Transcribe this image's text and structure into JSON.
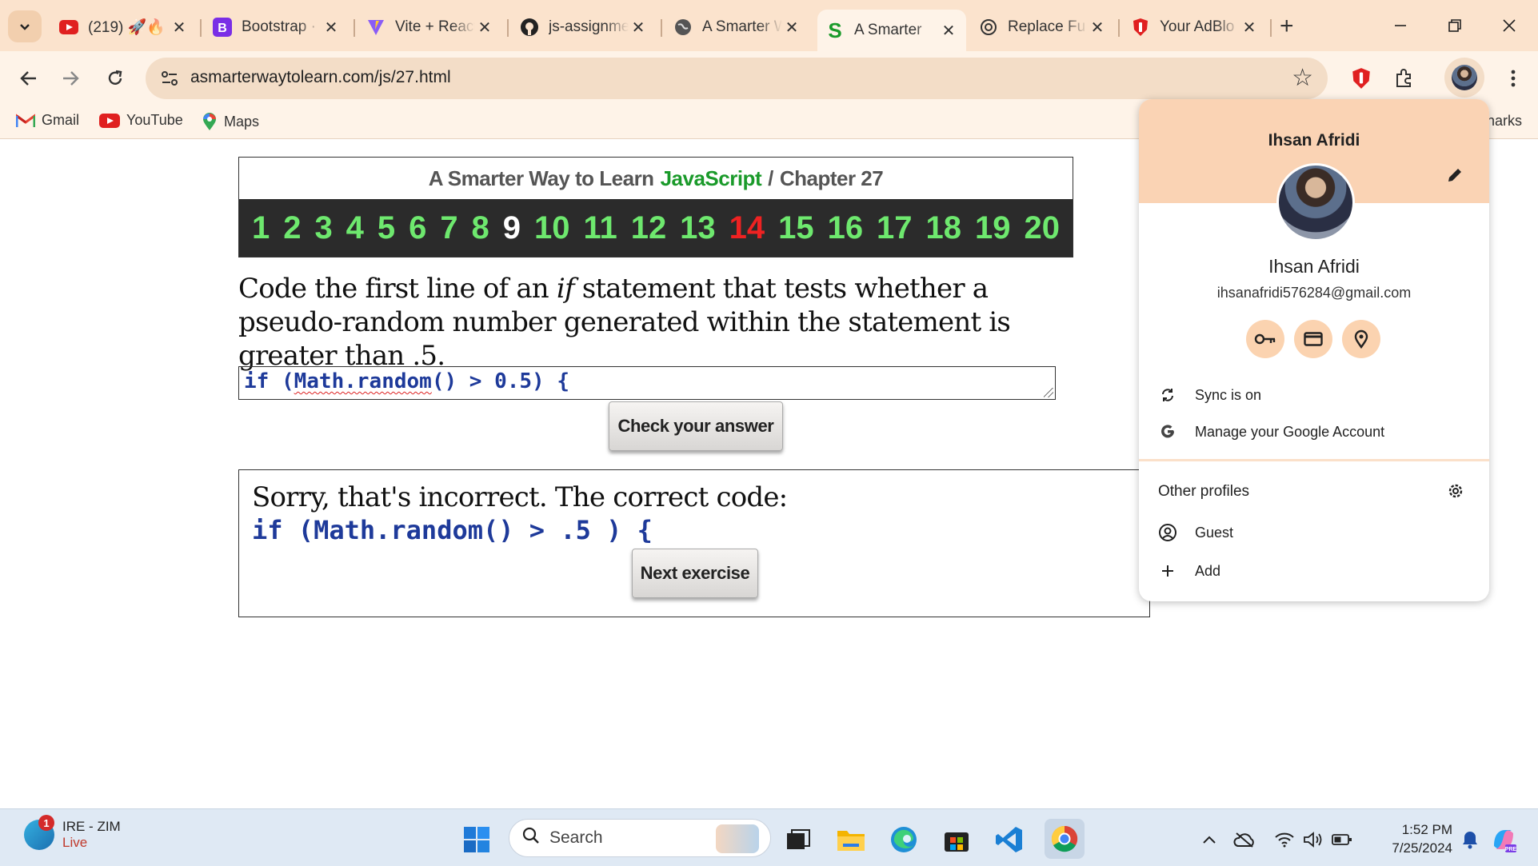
{
  "browser": {
    "tabs": [
      {
        "title": "(219) 🚀🔥",
        "icon": "youtube-icon"
      },
      {
        "title": "Bootstrap ·",
        "icon": "bootstrap-icon"
      },
      {
        "title": "Vite + React",
        "icon": "vite-icon"
      },
      {
        "title": "js-assignment",
        "icon": "github-icon"
      },
      {
        "title": "A Smarter W",
        "icon": "globe-icon"
      },
      {
        "title": "A Smarter",
        "icon": "smarter-icon",
        "active": true
      },
      {
        "title": "Replace Fu",
        "icon": "openai-icon"
      },
      {
        "title": "Your AdBlo",
        "icon": "adblock-icon"
      }
    ],
    "url": "asmarterwaytolearn.com/js/27.html",
    "bookmarks": [
      {
        "label": "Gmail",
        "icon": "gmail-icon"
      },
      {
        "label": "YouTube",
        "icon": "youtube-icon"
      },
      {
        "label": "Maps",
        "icon": "maps-icon"
      }
    ],
    "bookmarks_more": "narks"
  },
  "page": {
    "header": {
      "prefix": "A Smarter Way to Learn",
      "brand": "JavaScript",
      "separator": "/",
      "chapter": "Chapter 27"
    },
    "chapters": [
      "1",
      "2",
      "3",
      "4",
      "5",
      "6",
      "7",
      "8",
      "9",
      "10",
      "11",
      "12",
      "13",
      "14",
      "15",
      "16",
      "17",
      "18",
      "19",
      "20"
    ],
    "current_chapter": "9",
    "wrong_chapter": "14",
    "question": {
      "before": "Code the first line of an ",
      "emphasis": "if",
      "after": " statement that tests whether a pseudo-random number generated within the statement is greater than .5."
    },
    "answer": {
      "pre": "if (",
      "squiggle": "Math.random",
      "post": "() > 0.5) {"
    },
    "check_button": "Check your answer",
    "result": {
      "message": "Sorry, that's incorrect. The correct code:",
      "code": "if (Math.random() > .5 ) {"
    },
    "next_button": "Next exercise"
  },
  "profile": {
    "name_top": "Ihsan Afridi",
    "name": "Ihsan Afridi",
    "email": "ihsanafridi576284@gmail.com",
    "sync": "Sync is on",
    "manage": "Manage your Google Account",
    "other_profiles": "Other profiles",
    "guest": "Guest",
    "add": "Add"
  },
  "taskbar": {
    "weather_badge": "1",
    "weather_title": "IRE - ZIM",
    "weather_status": "Live",
    "search": "Search",
    "time": "1:52 PM",
    "date": "7/25/2024"
  },
  "colors": {
    "chrome_frame": "#fbe3cd",
    "toolbar": "#fef3e8",
    "chapter_green": "#6ee86e",
    "chapter_wrong": "#ee2222",
    "code_blue": "#1e3a9a",
    "brand_green": "#1a9a2a"
  }
}
